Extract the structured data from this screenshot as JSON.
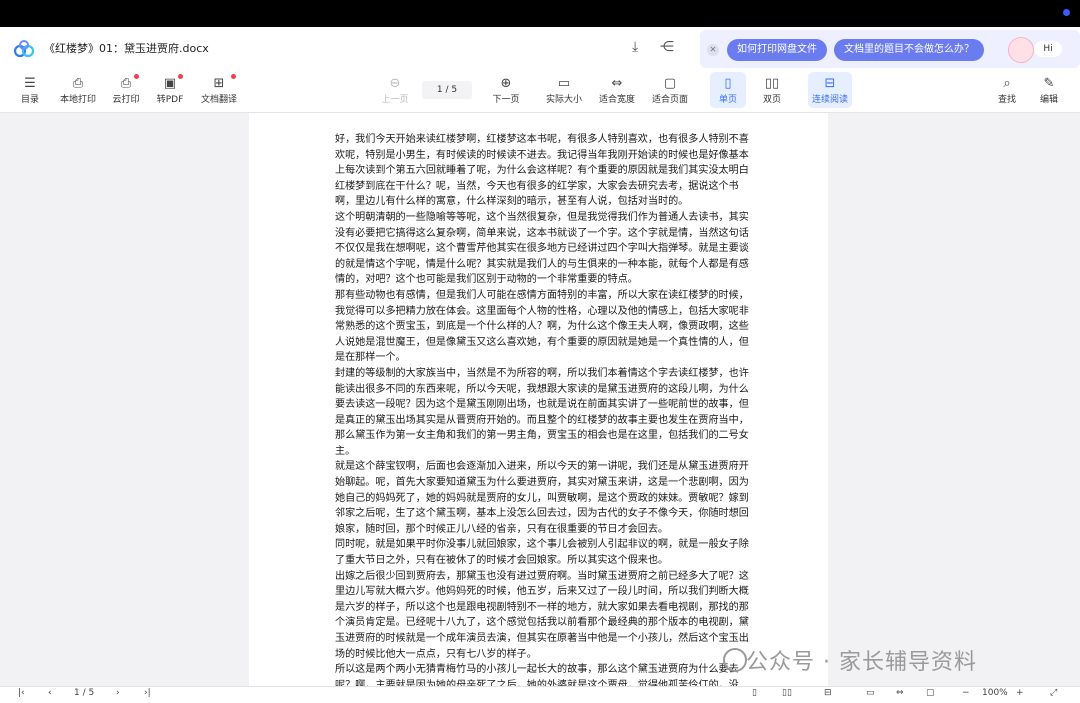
{
  "window": {
    "title": "《红楼梦》01：黛玉进贾府.docx"
  },
  "assistant": {
    "pill1": "如何打印网盘文件",
    "pill2": "文档里的题目不会做怎么办？",
    "hi": "Hi"
  },
  "toolbar": {
    "toc": "目录",
    "local_print": "本地打印",
    "cloud_print": "云打印",
    "to_pdf": "转PDF",
    "translate": "文档翻译",
    "prev_page": "上一页",
    "page_indicator": "1 / 5",
    "next_page": "下一页",
    "actual_size": "实际大小",
    "fit_width": "适合宽度",
    "fit_page": "适合页面",
    "single_page": "单页",
    "double_page": "双页",
    "continuous": "连续阅读",
    "search": "查找",
    "edit": "编辑"
  },
  "document": {
    "paragraphs": [
      "好，我们今天开始来读红楼梦啊，红楼梦这本书呢，有很多人特别喜欢，也有很多人特别不喜欢呢，特别是小男生，有时候读的时候读不进去。我记得当年我刚开始读的时候也是好像基本上每次读到个第五六回就睡着了呢，为什么会这样呢？有个重要的原因就是我们其实没太明白红楼梦到底在干什么？呢，当然，今天也有很多的红学家，大家会去研究去考，据说这个书啊，里边儿有什么样的寓意，什么样深刻的暗示，甚至有人说，包括对当时的。",
      "这个明朝清朝的一些隐喻等等呢，这个当然很复杂，但是我觉得我们作为普通人去读书，其实没有必要把它搞得这么复杂啊，简单来说，这本书就谈了一个字。这个字就是情，当然这句话不仅仅是我在想啊呢，这个曹雪芹他其实在很多地方已经讲过四个字叫大指弹琴。就是主要谈的就是情这个字呢，情是什么呢？其实就是我们人的与生俱来的一种本能，就每个人都是有感情的，对吧？这个也可能是我们区别于动物的一个非常重要的特点。",
      "那有些动物也有感情，但是我们人可能在感情方面特别的丰富，所以大家在读红楼梦的时候，我觉得可以多把精力放在体会。这里面每个人物的性格，心理以及他的情感上，包括大家呢非常熟悉的这个贾宝玉，到底是一个什么样的人？啊，为什么这个像王夫人啊，像贾政啊，这些人说她是混世魔王，但是像黛玉又这么喜欢她，有个重要的原因就是她是一个真性情的人，但是在那样一个。",
      "封建的等级制的大家族当中，当然是不为所容的啊，所以我们本着情这个字去读红楼梦，也许能读出很多不同的东西来呢，所以今天呢，我想跟大家读的是黛玉进贾府的这段儿啊，为什么要去读这一段呢？因为这个是黛玉刚刚出场，也就是说在前面其实讲了一些呢前世的故事，但是真正的黛玉出场其实是从晋贾府开始的。而且整个的红楼梦的故事主要也发生在贾府当中，那么黛玉作为第一女主角和我们的第一男主角，贾宝玉的相会也是在这里，包括我们的二号女主。",
      "就是这个薛宝钗啊，后面也会逐渐加入进来，所以今天的第一讲呢，我们还是从黛玉进贾府开始聊起。呢，首先大家要知道黛玉为什么要进贾府，其实对黛玉来讲，这是一个悲剧啊，因为她自己的妈妈死了，她的妈妈就是贾府的女儿，叫贾敏啊，是这个贾政的妹妹。贾敏呢？嫁到邻家之后呢，生了这个黛玉啊，基本上没怎么回去过，因为古代的女子不像今天，你随时想回娘家，随时回，那个时候正儿八经的省亲，只有在很重要的节日才会回去。",
      "同时呢，就是如果平时你没事儿就回娘家，这个事儿会被别人引起非议的啊，就是一般女子除了重大节日之外，只有在被休了的时候才会回娘家。所以其实这个假来也。",
      "出嫁之后很少回到贾府去，那黛玉也没有进过贾府啊。当时黛玉进贾府之前已经多大了呢？这里边儿写就大概六岁。他妈妈死的时候，他五岁，后来又过了一段儿时间，所以我们判断大概是六岁的样子，所以这个也是跟电视剧特别不一样的地方，就大家如果去看电视剧，那找的那个演员肯定是。已经呢十八九了，这个感觉包括我以前看那个最经典的那个版本的电视剧，黛玉进贾府的时候就是一个成年演员去演，但其实在原著当中他是一个小孩儿，然后这个宝玉出场的时候比他大一点点，只有七八岁的样子。",
      "所以这是两个两小无猜青梅竹马的小孩儿一起长大的故事，那么这个黛玉进贾府为什么要去呢？啊，主要就是因为她的母亲死了之后，她的外婆就是这个贾母，觉得他孤苦伶仃的，没"
    ]
  },
  "watermark": {
    "text": "公众号 · 家长辅导资料"
  },
  "statusbar": {
    "page_indicator": "1 / 5",
    "zoom": "100%",
    "minus": "−",
    "plus": "+"
  }
}
